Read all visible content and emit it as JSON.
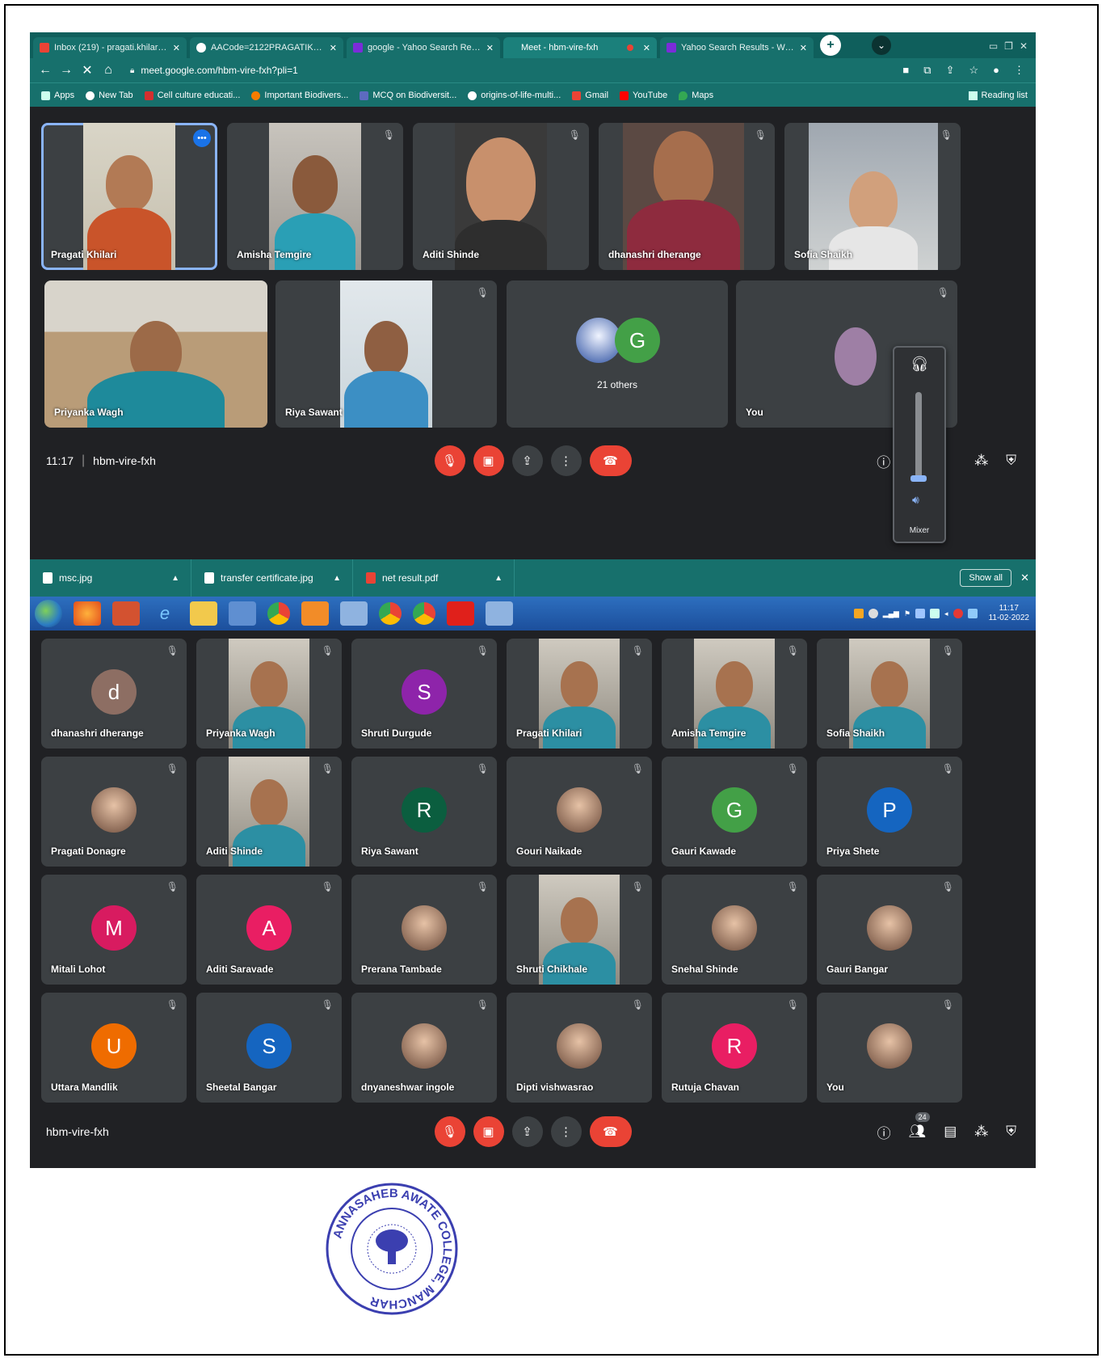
{
  "browser": {
    "tabs": [
      {
        "label": "Inbox (219) - pragati.khilari@...",
        "fav": "gmail-icon",
        "color": "#ea4335"
      },
      {
        "label": "AACode=2122PRAGATIKhilari",
        "fav": "globe-icon",
        "color": "#ffffff"
      },
      {
        "label": "google - Yahoo Search Results",
        "fav": "yahoo-icon",
        "color": "#7b2cd9"
      },
      {
        "label": "Meet - hbm-vire-fxh",
        "fav": "meet-icon",
        "color": "#ea4335"
      },
      {
        "label": "Yahoo Search Results - Web re",
        "fav": "yahoo-icon",
        "color": "#7b2cd9"
      }
    ],
    "url": "meet.google.com/hbm-vire-fxh?pli=1",
    "bookmarks": [
      "Apps",
      "New Tab",
      "Cell culture educati...",
      "Important Biodivers...",
      "MCQ on Biodiversit...",
      "origins-of-life-multi...",
      "Gmail",
      "YouTube",
      "Maps"
    ],
    "reading_list": "Reading list"
  },
  "meet_top": {
    "tiles": [
      {
        "name": "Pragati Khilari"
      },
      {
        "name": "Amisha Temgire"
      },
      {
        "name": "Aditi Shinde"
      },
      {
        "name": "dhanashri dherange"
      },
      {
        "name": "Sofia Shaikh"
      },
      {
        "name": "Priyanka Wagh"
      },
      {
        "name": "Riya Sawant"
      },
      {
        "name": "21 others",
        "avatar_letter": "G"
      },
      {
        "name": "You"
      }
    ],
    "time": "11:17",
    "meeting_code": "hbm-vire-fxh",
    "volume_popup": {
      "mixer_label": "Mixer"
    }
  },
  "downloads": {
    "items": [
      "msc.jpg",
      "transfer certificate.jpg",
      "net result.pdf"
    ],
    "show_all": "Show all"
  },
  "taskbar": {
    "time": "11:17",
    "date": "11-02-2022"
  },
  "meet_bottom": {
    "tiles": [
      {
        "name": "dhanashri dherange",
        "letter": "d",
        "color": "#8d6e63"
      },
      {
        "name": "Priyanka Wagh",
        "video": true
      },
      {
        "name": "Shruti Durgude",
        "letter": "S",
        "color": "#8e24aa"
      },
      {
        "name": "Pragati Khilari",
        "video": true
      },
      {
        "name": "Amisha Temgire",
        "video": true
      },
      {
        "name": "Sofia Shaikh",
        "video": true
      },
      {
        "name": "Pragati Donagre",
        "photo": true
      },
      {
        "name": "Aditi Shinde",
        "video": true
      },
      {
        "name": "Riya Sawant",
        "letter": "R",
        "color": "#0b5e3f"
      },
      {
        "name": "Gouri Naikade",
        "photo": true
      },
      {
        "name": "Gauri Kawade",
        "letter": "G",
        "color": "#43a047"
      },
      {
        "name": "Priya Shete",
        "letter": "P",
        "color": "#1565c0"
      },
      {
        "name": "Mitali Lohot",
        "letter": "M",
        "color": "#d81b60"
      },
      {
        "name": "Aditi Saravade",
        "letter": "A",
        "color": "#e91e63"
      },
      {
        "name": "Prerana Tambade",
        "photo": true
      },
      {
        "name": "Shruti Chikhale",
        "video": true
      },
      {
        "name": "Snehal Shinde",
        "photo": true
      },
      {
        "name": "Gauri Bangar",
        "photo": true
      },
      {
        "name": "Uttara Mandlik",
        "letter": "U",
        "color": "#ef6c00"
      },
      {
        "name": "Sheetal Bangar",
        "letter": "S",
        "color": "#1565c0"
      },
      {
        "name": "dnyaneshwar ingole",
        "photo": true
      },
      {
        "name": "Dipti vishwasrao",
        "photo": true
      },
      {
        "name": "Rutuja Chavan",
        "letter": "R",
        "color": "#e91e63"
      },
      {
        "name": "You",
        "photo": true
      }
    ],
    "meeting_code": "hbm-vire-fxh",
    "participants_count": "24"
  },
  "stamp": {
    "text": "ANNASAHEB AWATE COLLEGE, MANCHAR"
  }
}
